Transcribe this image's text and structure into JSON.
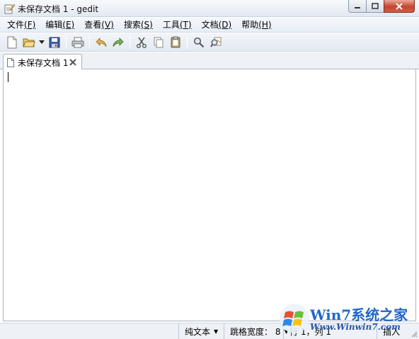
{
  "window": {
    "title": "未保存文档 1 - gedit",
    "icons": {
      "app": "gedit-edit-icon",
      "minimize": "minimize-icon",
      "maximize": "maximize-icon",
      "close": "close-icon"
    }
  },
  "menubar": {
    "items": [
      {
        "label": "文件",
        "accel": "(F)"
      },
      {
        "label": "编辑",
        "accel": "(E)"
      },
      {
        "label": "查看",
        "accel": "(V)"
      },
      {
        "label": "搜索",
        "accel": "(S)"
      },
      {
        "label": "工具",
        "accel": "(T)"
      },
      {
        "label": "文档",
        "accel": "(D)"
      },
      {
        "label": "帮助",
        "accel": "(H)"
      }
    ]
  },
  "toolbar": {
    "icons": [
      "new-document-icon",
      "open-folder-icon",
      "open-recent-dropdown-icon",
      "save-icon",
      "print-icon",
      "undo-icon",
      "redo-icon",
      "cut-icon",
      "copy-icon",
      "paste-icon",
      "find-icon",
      "find-replace-icon"
    ]
  },
  "tabs": [
    {
      "label": "未保存文档 1",
      "icon": "document-icon",
      "close_icon": "tab-close-icon"
    }
  ],
  "editor": {
    "content": ""
  },
  "statusbar": {
    "syntax": "纯文本",
    "tab_width": "跳格宽度： 8",
    "position": "行 1，列 1",
    "mode": "插入"
  },
  "watermark": {
    "brand": "Win7系统之家",
    "url": "Www.Winwin7.com"
  },
  "colors": {
    "chrome": "#e8eef6",
    "close_button": "#c7432b",
    "watermark_blue": "#2267c8"
  }
}
